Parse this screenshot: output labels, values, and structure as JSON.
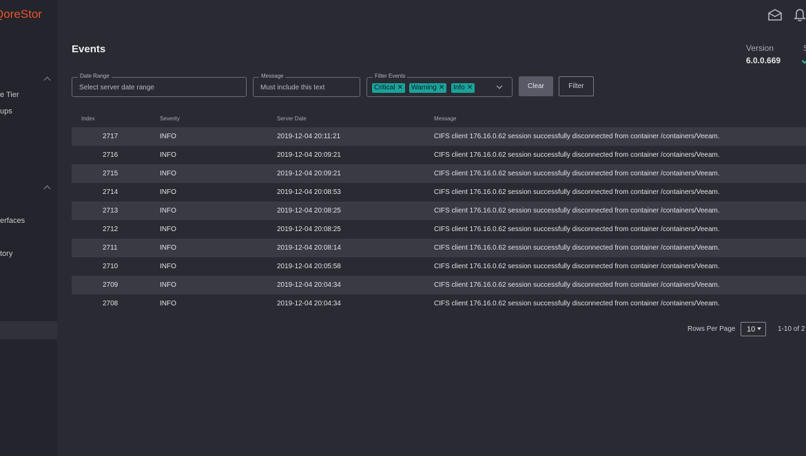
{
  "app": {
    "logo": "QoreStor"
  },
  "sidebar": {
    "items": [
      {
        "label": "e Tier"
      },
      {
        "label": "ups"
      },
      {
        "label": "erfaces"
      },
      {
        "label": "tory"
      }
    ]
  },
  "page": {
    "title": "Events"
  },
  "version": {
    "label": "Version",
    "value": "6.0.0.669",
    "cut_label": "S"
  },
  "filters": {
    "date_range": {
      "label": "Date Range",
      "placeholder": "Select server date range"
    },
    "message": {
      "label": "Message",
      "placeholder": "Must include this text"
    },
    "filter_events": {
      "label": "Filter Events",
      "chips": [
        "Critical",
        "Warning",
        "Info"
      ]
    },
    "clear_label": "Clear",
    "filter_label": "Filter"
  },
  "table": {
    "columns": [
      "Index",
      "Severity",
      "Server Date",
      "Message"
    ],
    "rows": [
      [
        "2717",
        "INFO",
        "2019-12-04 20:11:21",
        "CIFS client 176.16.0.62 session successfully disconnected from container /containers/Veeam."
      ],
      [
        "2716",
        "INFO",
        "2019-12-04 20:09:21",
        "CIFS client 176.16.0.62 session successfully disconnected from container /containers/Veeam."
      ],
      [
        "2715",
        "INFO",
        "2019-12-04 20:09:21",
        "CIFS client 176.16.0.62 session successfully disconnected from container /containers/Veeam."
      ],
      [
        "2714",
        "INFO",
        "2019-12-04 20:08:53",
        "CIFS client 176.16.0.62 session successfully disconnected from container /containers/Veeam."
      ],
      [
        "2713",
        "INFO",
        "2019-12-04 20:08:25",
        "CIFS client 176.16.0.62 session successfully disconnected from container /containers/Veeam."
      ],
      [
        "2712",
        "INFO",
        "2019-12-04 20:08:25",
        "CIFS client 176.16.0.62 session successfully disconnected from container /containers/Veeam."
      ],
      [
        "2711",
        "INFO",
        "2019-12-04 20:08:14",
        "CIFS client 176.16.0.62 session successfully disconnected from container /containers/Veeam."
      ],
      [
        "2710",
        "INFO",
        "2019-12-04 20:05:58",
        "CIFS client 176.16.0.62 session successfully disconnected from container /containers/Veeam."
      ],
      [
        "2709",
        "INFO",
        "2019-12-04 20:04:34",
        "CIFS client 176.16.0.62 session successfully disconnected from container /containers/Veeam."
      ],
      [
        "2708",
        "INFO",
        "2019-12-04 20:04:34",
        "CIFS client 176.16.0.62 session successfully disconnected from container /containers/Veeam."
      ]
    ]
  },
  "pagination": {
    "rows_per_page_label": "Rows Per Page",
    "rows_per_page": "10",
    "range": "1-10 of 2"
  },
  "colors": {
    "brand": "#e8552b",
    "chip": "#1aa39a",
    "background": "#2a2a33",
    "sidebar": "#24242c"
  },
  "icons": {
    "mail": "mail-icon",
    "bell": "bell-icon"
  }
}
